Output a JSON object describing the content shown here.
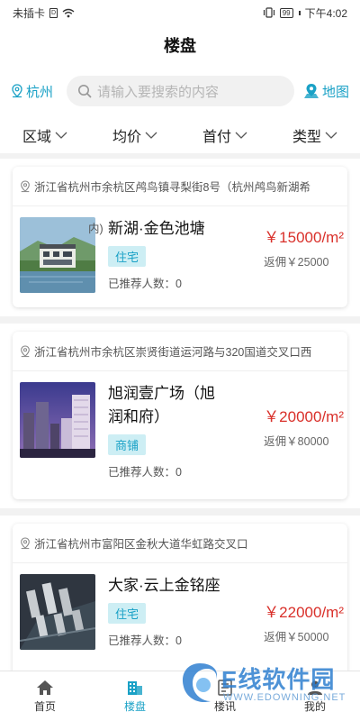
{
  "status_bar": {
    "carrier": "未插卡",
    "sim_glyph": "D",
    "battery": "99",
    "time": "下午4:02"
  },
  "header": {
    "title": "楼盘"
  },
  "search": {
    "city": "杭州",
    "placeholder": "请输入要搜索的内容",
    "map_label": "地图"
  },
  "filters": [
    {
      "label": "区域"
    },
    {
      "label": "均价"
    },
    {
      "label": "首付"
    },
    {
      "label": "类型"
    }
  ],
  "listings": [
    {
      "address": "浙江省杭州市余杭区鸬鸟镇寻梨街8号（杭州鸬鸟新湖希",
      "name": "新湖·金色池塘",
      "tag": "住宅",
      "referral": "已推荐人数：0",
      "price": "￥15000/m²",
      "rebate": "返佣￥25000"
    },
    {
      "address": "浙江省杭州市余杭区崇贤街道运河路与320国道交叉口西",
      "name": "旭润壹广场（旭润和府）",
      "tag": "商铺",
      "referral": "已推荐人数：0",
      "price": "￥20000/m²",
      "rebate": "返佣￥80000"
    },
    {
      "address": "浙江省杭州市富阳区金秋大道华虹路交叉口",
      "name": "大家·云上金铭座",
      "tag": "住宅",
      "referral": "已推荐人数：0",
      "price": "￥22000/m²",
      "rebate": "返佣￥50000"
    }
  ],
  "overlap_text": "内)",
  "bottom_nav": [
    {
      "label": "首页",
      "icon": "home-icon"
    },
    {
      "label": "楼盘",
      "icon": "building-icon"
    },
    {
      "label": "楼讯",
      "icon": "news-icon"
    },
    {
      "label": "我的",
      "icon": "profile-icon"
    }
  ],
  "watermark": {
    "title": "E线软件园",
    "url": "WWW.EDOWNING.NET"
  },
  "colors": {
    "accent": "#1aa1c6",
    "price": "#d9302a",
    "tag_bg": "#cdeef4"
  }
}
